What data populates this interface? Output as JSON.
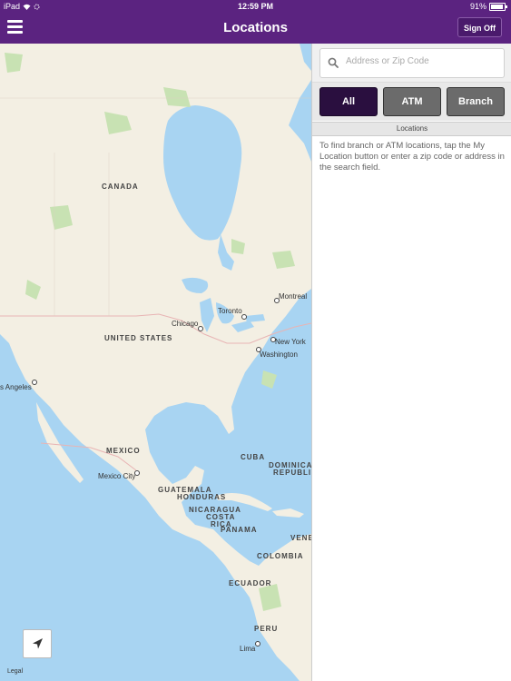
{
  "status_bar": {
    "device": "iPad",
    "time": "12:59 PM",
    "battery": "91%",
    "battery_level": 0.91
  },
  "nav": {
    "title": "Locations",
    "sign_off_label": "Sign Off",
    "menu_icon": "hamburger-menu-icon"
  },
  "map": {
    "countries": [
      "CANADA",
      "UNITED STATES",
      "MEXICO",
      "CUBA",
      "DOMINICA",
      "REPUBLIC",
      "GUATEMALA",
      "HONDURAS",
      "NICARAGUA",
      "COSTA",
      "RICA",
      "PANAMA",
      "COLOMBIA",
      "ECUADOR",
      "PERU",
      "VENE"
    ],
    "cities": [
      "Montreal",
      "Toronto",
      "Chicago",
      "New York",
      "Washington",
      "s Angeles",
      "Mexico City",
      "Lima"
    ],
    "legal_label": "Legal",
    "locate_icon": "location-arrow-icon"
  },
  "search": {
    "placeholder": "Address or Zip Code",
    "value": "",
    "icon": "search-icon"
  },
  "filters": {
    "all": "All",
    "atm": "ATM",
    "branch": "Branch",
    "selected": "All"
  },
  "results": {
    "header": "Locations",
    "info": "To find branch or ATM locations, tap the My Location button or enter a zip code or address in the search field."
  },
  "colors": {
    "brand_purple": "#5b2380",
    "selected_filter": "#2a0f3f",
    "unselected_filter": "#6b6b6b",
    "water": "#a8d4f2",
    "land": "#f3efe3"
  }
}
